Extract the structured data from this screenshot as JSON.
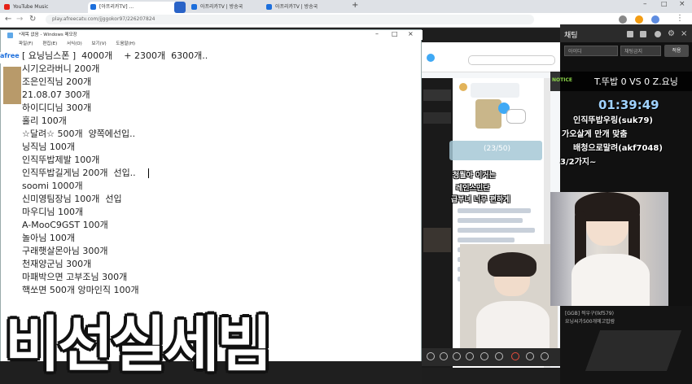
{
  "browser": {
    "tabs": [
      {
        "label": "YouTube Music",
        "fav_color": "#e62117"
      },
      {
        "label": "[아프리카TV] ...",
        "fav_color": "#1d6fdc"
      },
      {
        "label": "아프리카TV | 방송국",
        "fav_color": "#1d6fdc"
      },
      {
        "label": "아프리카TV | 방송국",
        "fav_color": "#1d6fdc"
      }
    ],
    "url": "play.afreecatv.com/jjggokor97/226207824"
  },
  "notepad": {
    "title": "*제목 없음 - Windows 메모장",
    "menu": [
      "파일(F)",
      "편집(E)",
      "서식(O)",
      "보기(V)",
      "도움말(H)"
    ],
    "lines": [
      "[ 요닝님스폰 ]  4000개    + 2300개  6300개..",
      "시기오라버니 200개",
      "조은인직님 200개",
      "21.08.07 300개",
      "하이디디님 300개",
      "홀리 100개",
      "☆달려☆ 500개  양쪽에선입..",
      "닝직님 100개",
      "인직뚜밥제발 100개",
      "인직뚜밥길게님 200개  선입..",
      "soomi 1000개",
      "신미영팀장님 100개  선입",
      "마우디님 100개",
      "A-MooC9GST 100개",
      "놀아님 100개",
      "구래햇살몬아님 300개",
      "천재양군님 300개",
      "",
      "마패박으면 고부조님 300개",
      "핵쏘면 500개 앙마인직 100개"
    ]
  },
  "afree": {
    "logo": "afree"
  },
  "broadcast_app": {
    "count_badge": "(23/50)",
    "overlay_lines": [
      "청월아 이거는",
      "레인스민단",
      "급부녀 너무 편하게"
    ]
  },
  "stream": {
    "chat_title": "채팅",
    "nickname_placeholder": "아이디",
    "select_value": "채팅금지",
    "action_button": "적용",
    "notice_tag": "NOTICE",
    "score": "T.뚜밥 0 VS 0 Z.요닝",
    "timer": "01:39:49",
    "chat_lines": [
      "인직뚜밥우링(suk79)",
      "가오살게 만개 맞춤",
      "배청으로말려(akf7048)",
      "3/2가지~"
    ],
    "bottom_chat": [
      "[GGB] 적우구(lkf579)",
      "요닝씨가500개에고맙람"
    ]
  },
  "caption": "비선실세빔"
}
